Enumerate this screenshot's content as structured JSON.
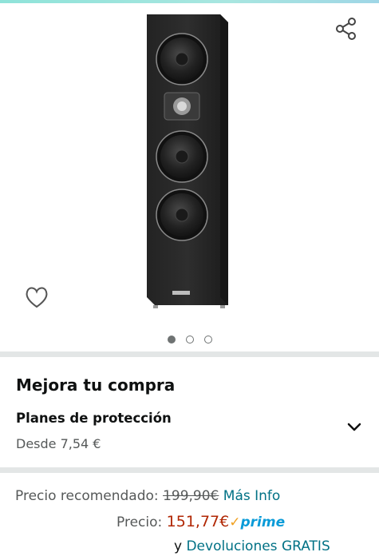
{
  "product": {
    "image_count": 3,
    "active_image": 1
  },
  "upgrade": {
    "title": "Mejora tu compra",
    "plans_title": "Planes de protección",
    "plans_from": "Desde 7,54 €"
  },
  "pricing": {
    "recommended_label": "Precio recomendado:",
    "recommended_price": "199,90€",
    "more_info": "Más Info",
    "price_label": "Precio:",
    "price": "151,77€",
    "prime_label": "prime",
    "returns_prefix": "y",
    "returns_link": "Devoluciones GRATIS"
  },
  "icons": {
    "share": "share-icon",
    "wishlist": "heart-icon",
    "expand": "chevron-down-icon",
    "prime_check": "check-icon"
  },
  "colors": {
    "price": "#b12704",
    "link": "#007185",
    "prime": "#0a9bd8",
    "muted": "#565959",
    "divider": "#e3e6e6"
  }
}
